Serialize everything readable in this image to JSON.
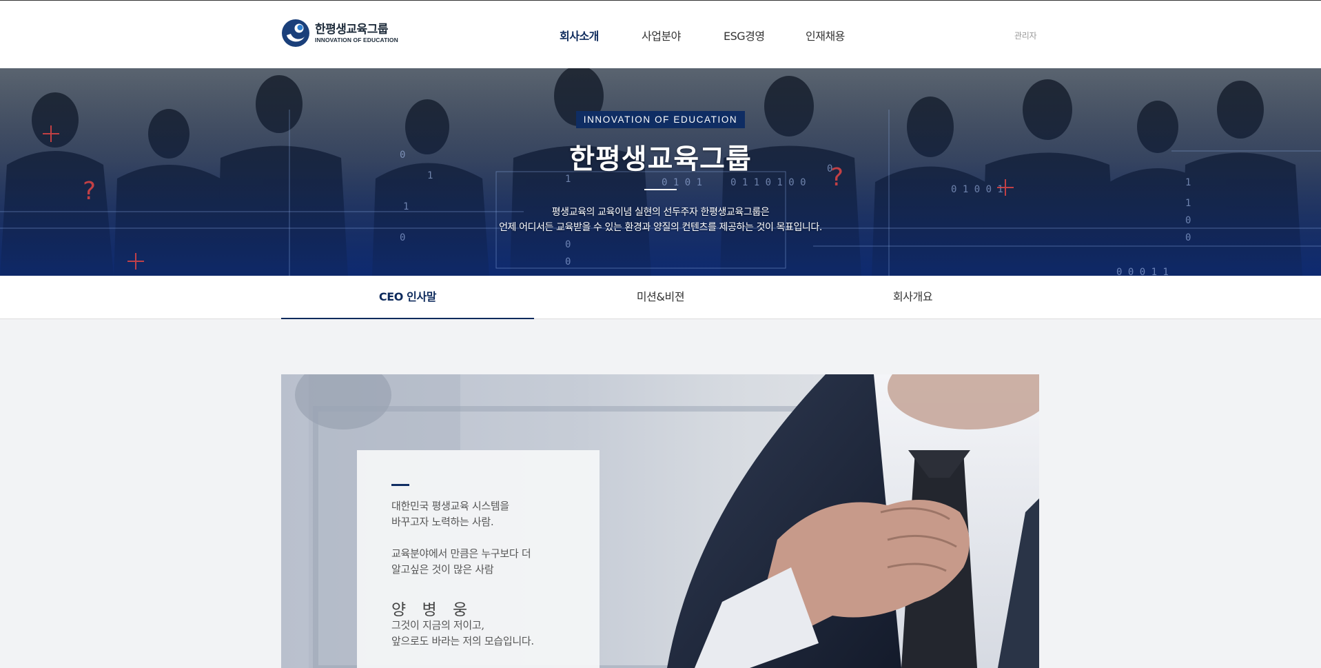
{
  "header": {
    "logo": {
      "name": "한평생교육그룹",
      "sub": "INNOVATION OF EDUCATION"
    },
    "nav": [
      {
        "label": "회사소개",
        "active": true
      },
      {
        "label": "사업분야",
        "active": false
      },
      {
        "label": "ESG경영",
        "active": false
      },
      {
        "label": "인재채용",
        "active": false
      }
    ],
    "admin_label": "관리자"
  },
  "hero": {
    "badge": "INNOVATION OF EDUCATION",
    "title": "한평생교육그룹",
    "desc_line1": "평생교육의 교육이념 실현의 선두주자 한평생교육그룹은",
    "desc_line2": "언제 어디서든 교육받을 수 있는 환경과 양질의 컨텐츠를 제공하는 것이 목표입니다."
  },
  "subtabs": [
    {
      "label": "CEO 인사말",
      "active": true
    },
    {
      "label": "미션&비젼",
      "active": false
    },
    {
      "label": "회사개요",
      "active": false
    }
  ],
  "ceo": {
    "para1_line1": "대한민국 평생교육 시스템을",
    "para1_line2": "바꾸고자 노력하는 사람.",
    "para2_line1": "교육분야에서 만큼은 누구보다 더",
    "para2_line2": "알고싶은 것이 많은 사람",
    "name": "양 병 웅",
    "para3_line1": "그것이 지금의 저이고,",
    "para3_line2": "앞으로도 바라는 저의 모습입니다."
  },
  "colors": {
    "brand_navy": "#0f2d63",
    "nav_active": "#0d2a5c",
    "page_bg": "#f2f3f5"
  }
}
